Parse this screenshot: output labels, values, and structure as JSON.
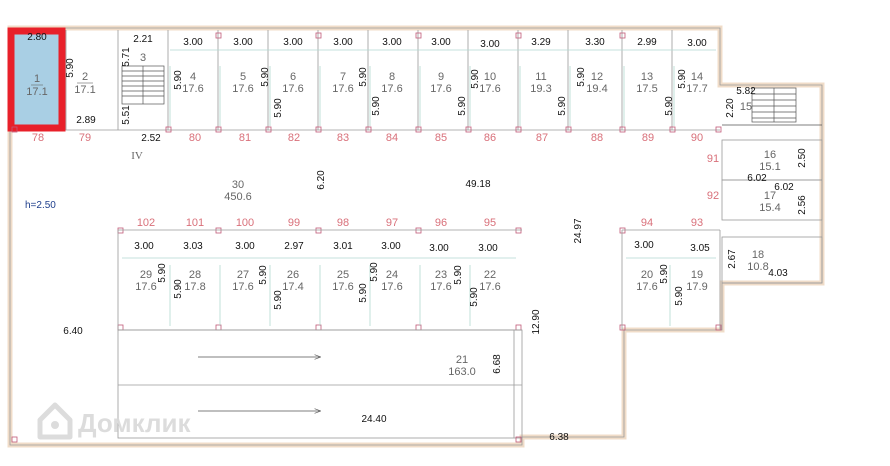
{
  "plan": {
    "ceiling_height": "h=2.50",
    "section_label": "IV",
    "watermark": "Домклик",
    "colors": {
      "wall": "#f0dcc8",
      "line": "#808080",
      "highlight": "#e8202a",
      "highlight_fill": "#a9cfe4",
      "column": "#c05a78",
      "grid": "#b3d9d0"
    },
    "rooms": [
      {
        "num": "1",
        "area": "17.1"
      },
      {
        "num": "2",
        "area": "17.1"
      },
      {
        "num": "3",
        "area": ""
      },
      {
        "num": "4",
        "area": "17.6"
      },
      {
        "num": "5",
        "area": "17.6"
      },
      {
        "num": "6",
        "area": "17.6"
      },
      {
        "num": "7",
        "area": "17.6"
      },
      {
        "num": "8",
        "area": "17.6"
      },
      {
        "num": "9",
        "area": "17.6"
      },
      {
        "num": "10",
        "area": "17.6"
      },
      {
        "num": "11",
        "area": "19.3"
      },
      {
        "num": "12",
        "area": "19.4"
      },
      {
        "num": "13",
        "area": "17.5"
      },
      {
        "num": "14",
        "area": "17.7"
      },
      {
        "num": "15",
        "area": ""
      },
      {
        "num": "16",
        "area": "15.1"
      },
      {
        "num": "17",
        "area": "15.4"
      },
      {
        "num": "18",
        "area": "10.8"
      },
      {
        "num": "19",
        "area": "17.9"
      },
      {
        "num": "20",
        "area": "17.6"
      },
      {
        "num": "21",
        "area": "163.0"
      },
      {
        "num": "22",
        "area": "17.6"
      },
      {
        "num": "23",
        "area": "17.6"
      },
      {
        "num": "24",
        "area": "17.6"
      },
      {
        "num": "25",
        "area": "17.6"
      },
      {
        "num": "26",
        "area": "17.4"
      },
      {
        "num": "27",
        "area": "17.6"
      },
      {
        "num": "28",
        "area": "17.8"
      },
      {
        "num": "29",
        "area": "17.6"
      },
      {
        "num": "30",
        "area": "450.6"
      }
    ],
    "parking_numbers": [
      "78",
      "79",
      "80",
      "81",
      "82",
      "83",
      "84",
      "85",
      "86",
      "87",
      "88",
      "89",
      "90",
      "91",
      "92",
      "93",
      "94",
      "95",
      "96",
      "97",
      "98",
      "99",
      "100",
      "101",
      "102"
    ],
    "dimensions": {
      "top_widths": [
        "2.21",
        "3.00",
        "3.00",
        "3.00",
        "3.00",
        "3.00",
        "3.00",
        "3.00",
        "3.29",
        "3.30",
        "2.99",
        "3.00"
      ],
      "top_depths": [
        "5.90",
        "5.90",
        "5.90",
        "5.90",
        "5.90",
        "5.90",
        "5.90",
        "5.90",
        "5.90",
        "5.90",
        "5.90"
      ],
      "bottom_widths": [
        "3.00",
        "3.03",
        "3.00",
        "2.97",
        "3.01",
        "3.00",
        "3.00",
        "3.00",
        "3.00",
        "3.05"
      ],
      "bottom_depths": [
        "5.90",
        "5.90",
        "5.90",
        "5.90",
        "5.90",
        "5.90",
        "5.90",
        "5.90",
        "5.90",
        "5.90",
        "5.90",
        "5.90"
      ],
      "room1_top": "2.80",
      "room1_side": "5.90",
      "room2_bottom": "2.89",
      "stair_top": "5.71",
      "stair_bottom": "5.51",
      "stair_width": "2.52",
      "right_stair_width": "5.82",
      "right_stair_side": "2.20",
      "room16_width": "6.02",
      "room16_height": "2.50",
      "room17_width": "6.02",
      "room17_height": "2.56",
      "room18_height": "2.67",
      "room18_width": "4.03",
      "aisle_width": "6.20",
      "hall_length": "49.18",
      "hall_depth": "24.97",
      "left_width": "6.40",
      "ramp_height": "12.90",
      "ramp_width": "6.68",
      "ramp_length": "24.40",
      "corner_width": "6.38"
    }
  }
}
